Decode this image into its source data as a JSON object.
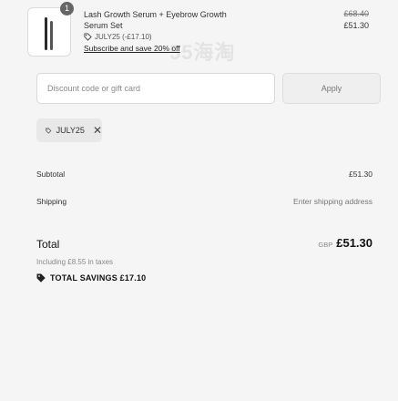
{
  "product": {
    "quantity": "1",
    "name_line1": "Lash Growth Serum + Eyebrow Growth",
    "name_line2": "Serum Set",
    "price_original": "£68.40",
    "price_current": "£51.30",
    "discount_line": "JULY25 (-£17.10)",
    "subscribe_link": "Subscribe and save 20% off"
  },
  "discount": {
    "placeholder": "Discount code or gift card",
    "apply_label": "Apply",
    "applied_code": "JULY25",
    "remove_symbol": "✕"
  },
  "summary": {
    "subtotal_label": "Subtotal",
    "subtotal_value": "£51.30",
    "shipping_label": "Shipping",
    "shipping_value": "Enter shipping address",
    "total_label": "Total",
    "total_currency": "GBP",
    "total_value": "£51.30",
    "taxes_note": "Including £8.55 in taxes",
    "savings_text": "TOTAL SAVINGS £17.10"
  },
  "watermark_text": "55海淘",
  "icons": {
    "tag": "tag-icon",
    "close": "close-icon"
  },
  "colors": {
    "background": "#f5f5f5",
    "text": "#1a1a1a",
    "muted": "#777777"
  }
}
